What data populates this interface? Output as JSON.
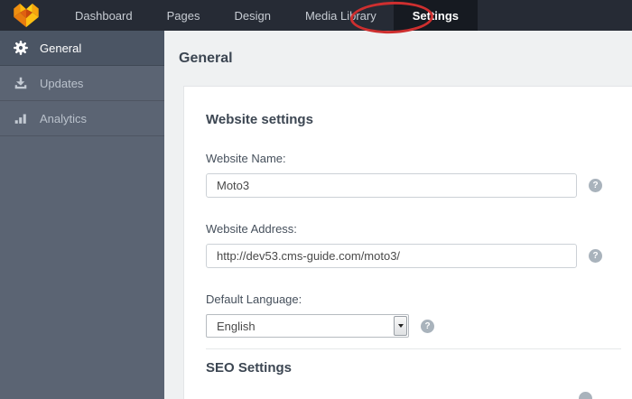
{
  "topbar": {
    "nav": [
      {
        "label": "Dashboard"
      },
      {
        "label": "Pages"
      },
      {
        "label": "Design"
      },
      {
        "label": "Media Library"
      },
      {
        "label": "Settings",
        "active": true
      }
    ]
  },
  "annotation": {
    "shape": "ellipse",
    "color": "#ce2f2f",
    "target": "Settings"
  },
  "sidebar": {
    "items": [
      {
        "label": "General",
        "icon": "gear-icon",
        "active": true
      },
      {
        "label": "Updates",
        "icon": "download-icon"
      },
      {
        "label": "Analytics",
        "icon": "bar-chart-icon"
      }
    ]
  },
  "page": {
    "title": "General"
  },
  "sections": [
    {
      "heading": "Website settings",
      "fields": [
        {
          "label": "Website Name:",
          "type": "text",
          "value": "Moto3",
          "help": "?"
        },
        {
          "label": "Website Address:",
          "type": "text",
          "value": "http://dev53.cms-guide.com/moto3/",
          "help": "?"
        },
        {
          "label": "Default Language:",
          "type": "select",
          "value": "English",
          "help": "?"
        }
      ]
    },
    {
      "heading": "SEO Settings"
    }
  ],
  "colors": {
    "topbar_bg": "#262b35",
    "active_tab_bg": "#161a21",
    "sidebar_bg": "#5b6473",
    "sidebar_active_bg": "#4b5564",
    "main_bg": "#eff1f2",
    "card_bg": "#ffffff",
    "heading_text": "#3c4652",
    "help_icon_bg": "#a9b3bc",
    "logo_orange": "#ef8f10",
    "logo_yellow": "#ffcf17",
    "logo_red": "#c9480c"
  }
}
